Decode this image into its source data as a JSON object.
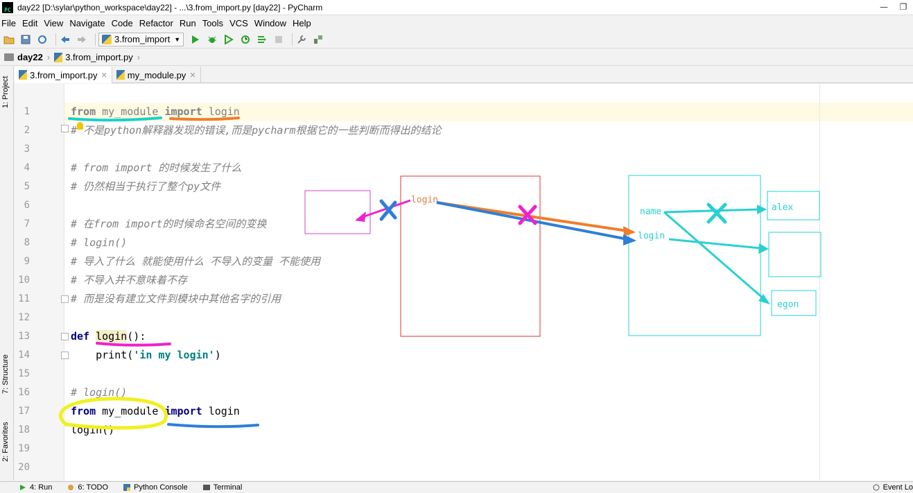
{
  "window": {
    "title": "day22 [D:\\sylar\\python_workspace\\day22] - ...\\3.from_import.py [day22] - PyCharm",
    "logo_text": "PC"
  },
  "menu": [
    "File",
    "Edit",
    "View",
    "Navigate",
    "Code",
    "Refactor",
    "Run",
    "Tools",
    "VCS",
    "Window",
    "Help"
  ],
  "toolbar": {
    "run_config": "3.from_import"
  },
  "breadcrumb": {
    "project": "day22",
    "file": "3.from_import.py"
  },
  "left_tool_tabs": {
    "project": "1: Project",
    "structure": "7: Structure",
    "favorites": "2: Favorites"
  },
  "editor_tabs": [
    {
      "label": "3.from_import.py",
      "active": true
    },
    {
      "label": "my_module.py",
      "active": false
    }
  ],
  "code": {
    "line_numbers": [
      "1",
      "2",
      "3",
      "4",
      "5",
      "6",
      "7",
      "8",
      "9",
      "10",
      "11",
      "12",
      "13",
      "14",
      "15",
      "16",
      "17",
      "18",
      "19",
      "20"
    ],
    "l1": {
      "kw1": "from",
      "mod": "my_module",
      "kw2": "import",
      "name": "login"
    },
    "l2": "# 不是python解释器发现的错误,而是pycharm根据它的一些判断而得出的结论",
    "l4": "# from import 的时候发生了什么",
    "l5": "# 仍然相当于执行了整个py文件",
    "l7": "# 在from import的时候命名空间的变换",
    "l8": "# login()",
    "l9": "# 导入了什么 就能使用什么 不导入的变量 不能使用",
    "l10": "# 不导入并不意味着不存",
    "l11": "# 而是没有建立文件到模块中其他名字的引用",
    "l13": {
      "kw": "def",
      "name": "login",
      "rest": "():"
    },
    "l14": {
      "fn": "print(",
      "str": "'in my login'",
      "close": ")"
    },
    "l16": "# login()",
    "l17": {
      "kw1": "from",
      "mod": "my_module",
      "kw2": "import",
      "name": "login"
    },
    "l18": "login()"
  },
  "diagram": {
    "center_login": "login",
    "module_name": "name",
    "module_login": "login",
    "alex": "alex",
    "egon": "egon"
  },
  "statusbar": {
    "run": "4: Run",
    "todo": "6: TODO",
    "console": "Python Console",
    "terminal": "Terminal",
    "event_log": "Event Lo"
  }
}
